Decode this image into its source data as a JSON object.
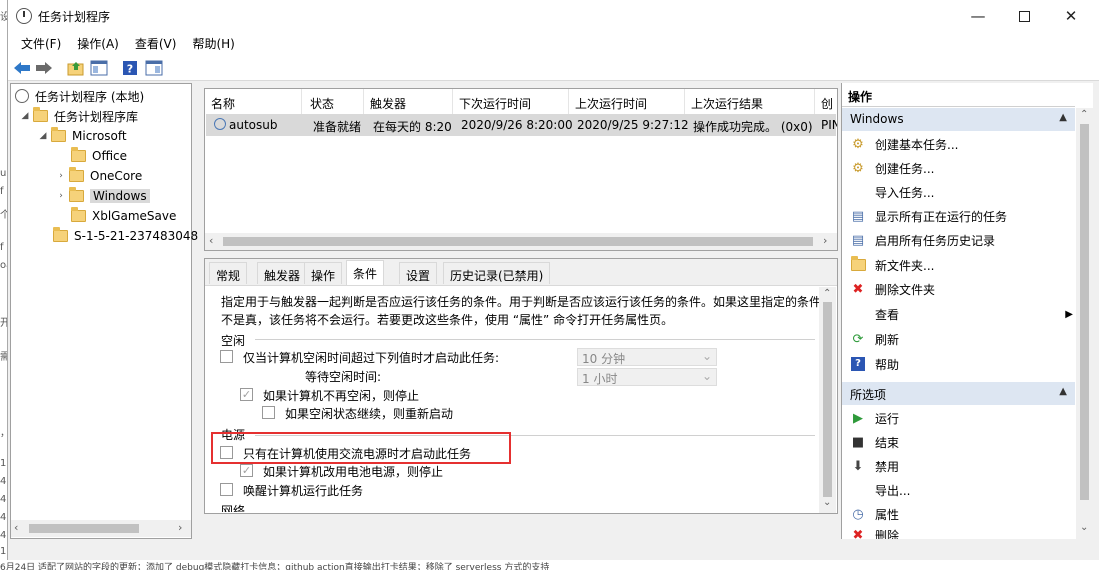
{
  "window": {
    "title": "任务计划程序"
  },
  "menu": [
    "文件(F)",
    "操作(A)",
    "查看(V)",
    "帮助(H)"
  ],
  "tree": {
    "root": "任务计划程序 (本地)",
    "library": "任务计划程序库",
    "microsoft": "Microsoft",
    "folders": [
      "Office",
      "OneCore",
      "Windows",
      "XblGameSave"
    ],
    "sid": "S-1-5-21-237483048"
  },
  "task_list": {
    "columns": [
      "名称",
      "状态",
      "触发器",
      "下次运行时间",
      "上次运行时间",
      "上次运行结果",
      "创建"
    ],
    "rows": [
      {
        "name": "autosub",
        "status": "准备就绪",
        "trigger": "在每天的 8:20",
        "next_run": "2020/9/26 8:20:00",
        "last_run": "2020/9/25 9:27:12",
        "result": "操作成功完成。 (0x0)",
        "creator": "PIN"
      }
    ]
  },
  "tabs": [
    "常规",
    "触发器",
    "操作",
    "条件",
    "设置",
    "历史记录(已禁用)"
  ],
  "conditions": {
    "description": "指定用于与触发器一起判断是否应运行该任务的条件。用于判断是否应该运行该任务的条件。如果这里指定的条件不是真，该任务将不会运行。若要更改这些条件，使用 “属性” 命令打开任务属性页。",
    "idle_title": "空闲",
    "idle_start": "仅当计算机空闲时间超过下列值时才启动此任务:",
    "idle_wait": "等待空闲时间:",
    "idle_duration": "10 分钟",
    "idle_wait_value": "1 小时",
    "idle_stop": "如果计算机不再空闲，则停止",
    "idle_restart": "如果空闲状态继续，则重新启动",
    "power_title": "电源",
    "power_ac": "只有在计算机使用交流电源时才启动此任务",
    "power_battery": "如果计算机改用电池电源，则停止",
    "wake": "唤醒计算机运行此任务",
    "network_title": "网络"
  },
  "actions": {
    "header": "操作",
    "windows_header": "Windows",
    "windows_items": [
      "创建基本任务...",
      "创建任务...",
      "导入任务...",
      "显示所有正在运行的任务",
      "启用所有任务历史记录",
      "新文件夹...",
      "删除文件夹",
      "查看",
      "刷新",
      "帮助"
    ],
    "selected_header": "所选项",
    "selected_items": [
      "运行",
      "结束",
      "禁用",
      "导出...",
      "属性",
      "删除"
    ]
  },
  "bottom_text": "6月24日 适配了网站的字段的更新；添加了 debug模式隐藏打卡信息；github action直接输出打卡结果；移除了 serverless 方式的支持",
  "left_strip": [
    "设",
    "u",
    "f",
    "个",
    "f",
    "oa",
    "开",
    "需",
    "，",
    "1",
    "4",
    "4",
    "4",
    "4",
    "1",
    "2"
  ],
  "colors": {
    "highlight": "#e53030",
    "selected": "#cce8ff",
    "section_header": "#dde6f2"
  }
}
